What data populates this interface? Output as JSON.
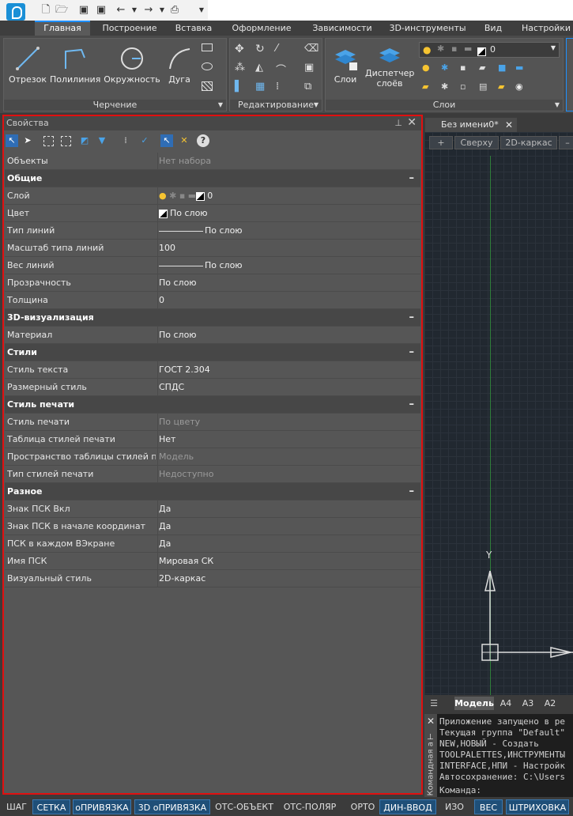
{
  "ribbon": {
    "tabs": [
      "Главная",
      "Построение",
      "Вставка",
      "Оформление",
      "Зависимости",
      "3D-инструменты",
      "Вид",
      "Настройки"
    ],
    "active_tab": "Главная",
    "draw_panel": {
      "title": "Черчение",
      "buttons": [
        "Отрезок",
        "Полилиния",
        "Окружность",
        "Дуга"
      ]
    },
    "edit_panel": {
      "title": "Редактирование"
    },
    "layers_panel": {
      "title": "Слои",
      "buttons": [
        "Слои",
        "Диспетчер слоёв"
      ],
      "current_layer": "0"
    }
  },
  "properties": {
    "title": "Свойства",
    "rows": [
      {
        "type": "row",
        "key": "Объекты",
        "value": "Нет набора",
        "dim": true
      },
      {
        "type": "section",
        "key": "Общие"
      },
      {
        "type": "row",
        "key": "Слой",
        "value": "0",
        "kind": "layer"
      },
      {
        "type": "row",
        "key": "Цвет",
        "value": "По слою",
        "kind": "color"
      },
      {
        "type": "row",
        "key": "Тип линий",
        "value": "По слою",
        "kind": "line"
      },
      {
        "type": "row",
        "key": "Масштаб типа линий",
        "value": "100"
      },
      {
        "type": "row",
        "key": "Вес линий",
        "value": "По слою",
        "kind": "line"
      },
      {
        "type": "row",
        "key": "Прозрачность",
        "value": "По слою"
      },
      {
        "type": "row",
        "key": "Толщина",
        "value": "0"
      },
      {
        "type": "section",
        "key": "3D-визуализация"
      },
      {
        "type": "row",
        "key": "Материал",
        "value": "По слою"
      },
      {
        "type": "section",
        "key": "Стили"
      },
      {
        "type": "row",
        "key": "Стиль текста",
        "value": "ГОСТ 2.304"
      },
      {
        "type": "row",
        "key": "Размерный стиль",
        "value": "СПДС"
      },
      {
        "type": "section",
        "key": "Стиль печати"
      },
      {
        "type": "row",
        "key": "Стиль печати",
        "value": "По цвету",
        "dim": true
      },
      {
        "type": "row",
        "key": "Таблица стилей печати",
        "value": "Нет"
      },
      {
        "type": "row",
        "key": "Пространство таблицы стилей пе...",
        "value": "Модель",
        "dim": true
      },
      {
        "type": "row",
        "key": "Тип стилей печати",
        "value": "Недоступно",
        "dim": true
      },
      {
        "type": "section",
        "key": "Разное"
      },
      {
        "type": "row",
        "key": "Знак ПСК Вкл",
        "value": "Да"
      },
      {
        "type": "row",
        "key": "Знак ПСК в начале координат",
        "value": "Да"
      },
      {
        "type": "row",
        "key": "ПСК в каждом ВЭкране",
        "value": "Да"
      },
      {
        "type": "row",
        "key": "Имя ПСК",
        "value": "Мировая СК"
      },
      {
        "type": "row",
        "key": "Визуальный стиль",
        "value": "2D-каркас"
      }
    ]
  },
  "drawing": {
    "tab_name": "Без имени0*",
    "view_buttons": [
      "+",
      "Сверху",
      "2D-каркас",
      "–"
    ],
    "ucs_y_label": "Y",
    "layout_tabs": [
      "Модель",
      "A4",
      "A3",
      "A2"
    ],
    "active_layout": "Модель"
  },
  "command_window": {
    "side_label": "Командная а",
    "lines": [
      "Приложение запущено в ре",
      "Текущая группа \"Default\"",
      "NEW,НОВЫЙ - Создать",
      "TOOLPALETTES,ИНСТРУМЕНТЫ",
      "INTERFACE,НПИ - Настройк",
      "Автосохранение: C:\\Users"
    ],
    "prompt": "Команда:"
  },
  "status_bar": [
    {
      "label": "ШАГ",
      "on": false
    },
    {
      "label": "СЕТКА",
      "on": true
    },
    {
      "label": "оПРИВЯЗКА",
      "on": true
    },
    {
      "label": "3D оПРИВЯЗКА",
      "on": true
    },
    {
      "label": "ОТС-ОБЪЕКТ",
      "on": false
    },
    {
      "label": "ОТС-ПОЛЯР",
      "on": false
    },
    {
      "label": "ОРТО",
      "on": false
    },
    {
      "label": "ДИН-ВВОД",
      "on": true
    },
    {
      "label": "ИЗО",
      "on": false
    },
    {
      "label": "ВЕС",
      "on": true
    },
    {
      "label": "ШТРИХОВКА",
      "on": true
    }
  ]
}
